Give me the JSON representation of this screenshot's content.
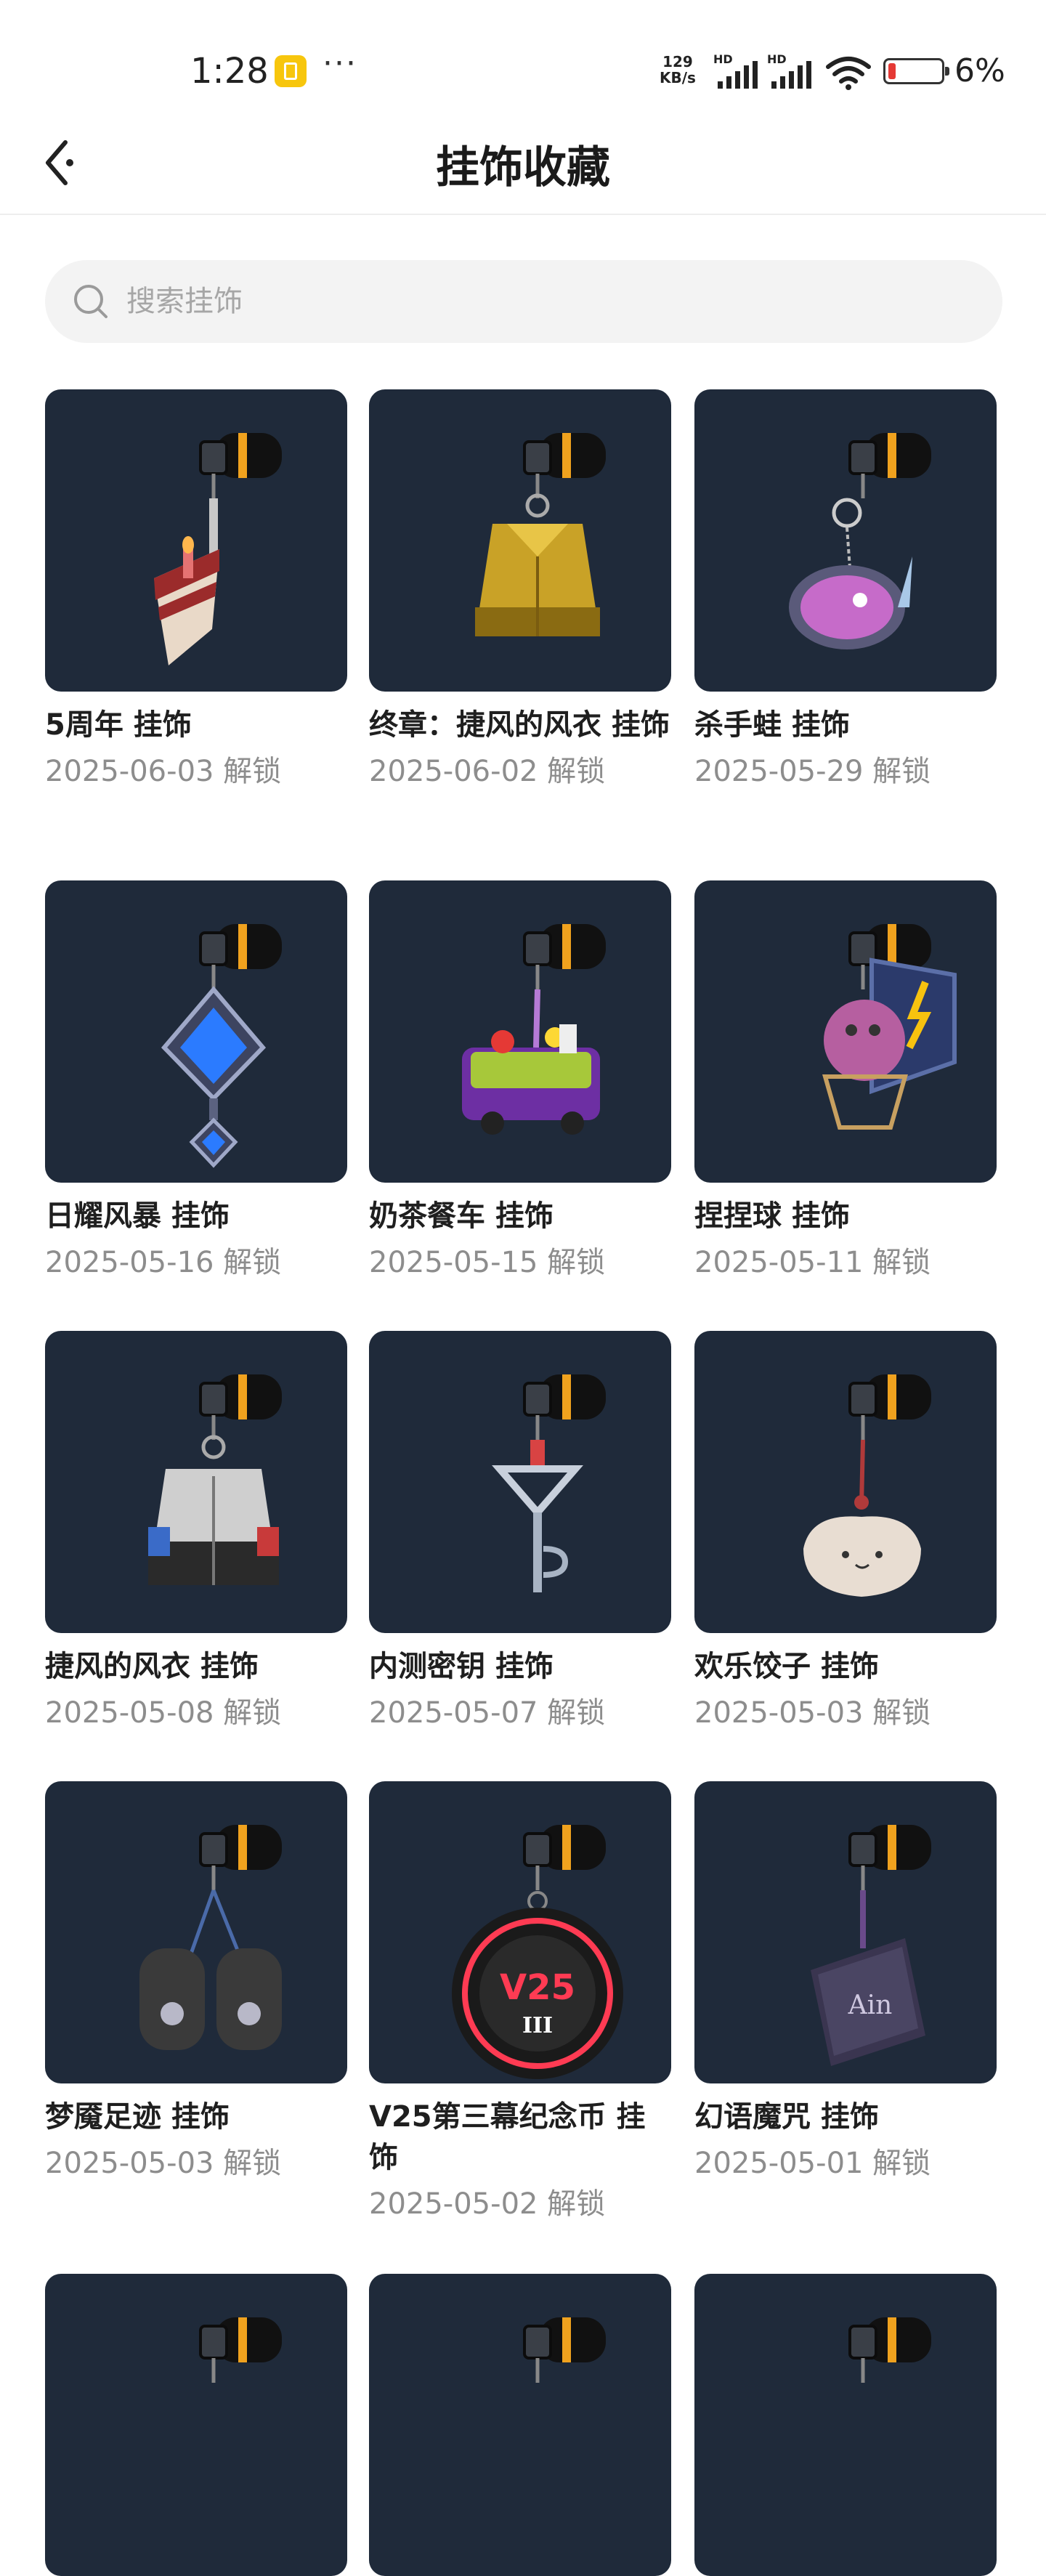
{
  "status_bar": {
    "time": "1:28",
    "dots": "···",
    "net_speed_value": "129",
    "net_speed_unit": "KB/s",
    "hd1": "HD",
    "hd2": "HD",
    "battery_percent": "6%"
  },
  "header": {
    "title": "挂饰收藏"
  },
  "search": {
    "placeholder": "搜索挂饰"
  },
  "items": [
    {
      "name": "5周年 挂饰",
      "date": "2025-06-03 解锁",
      "icon": "cake-slice-fork-charm"
    },
    {
      "name": "终章：捷风的风衣 挂饰",
      "date": "2025-06-02 解锁",
      "icon": "gold-jacket-charm"
    },
    {
      "name": "杀手蛙 挂饰",
      "date": "2025-05-29 解锁",
      "icon": "frog-knife-charm"
    },
    {
      "name": "日耀风暴 挂饰",
      "date": "2025-05-16 解锁",
      "icon": "blue-crystal-charm"
    },
    {
      "name": "奶茶餐车 挂饰",
      "date": "2025-05-15 解锁",
      "icon": "food-truck-charm"
    },
    {
      "name": "捏捏球 挂饰",
      "date": "2025-05-11 解锁",
      "icon": "squeeze-ball-hoop-charm"
    },
    {
      "name": "捷风的风衣 挂饰",
      "date": "2025-05-08 解锁",
      "icon": "jacket-charm"
    },
    {
      "name": "内测密钥 挂饰",
      "date": "2025-05-07 解锁",
      "icon": "key-charm"
    },
    {
      "name": "欢乐饺子 挂饰",
      "date": "2025-05-03 解锁",
      "icon": "dumpling-charm"
    },
    {
      "name": "梦魇足迹 挂饰",
      "date": "2025-05-03 解锁",
      "icon": "paw-boots-charm"
    },
    {
      "name": "V25第三幕纪念币 挂饰",
      "date": "2025-05-02 解锁",
      "icon": "v25-coin-charm"
    },
    {
      "name": "幻语魔咒 挂饰",
      "date": "2025-05-01 解锁",
      "icon": "spellbook-charm"
    },
    {
      "name": "",
      "date": "",
      "icon": "charm"
    },
    {
      "name": "",
      "date": "",
      "icon": "charm"
    },
    {
      "name": "",
      "date": "",
      "icon": "charm"
    }
  ],
  "colors": {
    "thumb_bg": "#1f2a3a",
    "accent_orange": "#f0a21e",
    "text_primary": "#1f1f1f",
    "text_secondary": "#8d8d8d",
    "battery_low": "#e53935"
  }
}
